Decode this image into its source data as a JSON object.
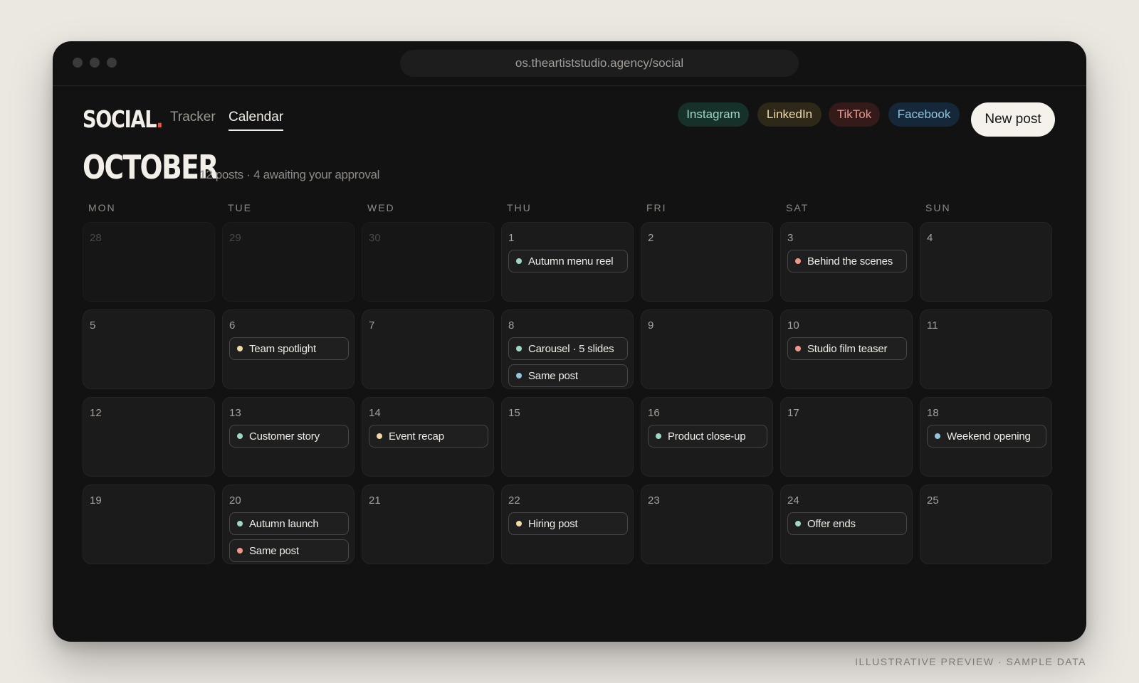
{
  "browser": {
    "url": "os.theartiststudio.agency/social"
  },
  "app": {
    "logo": "SOCIAL",
    "logo_dot": "."
  },
  "nav": {
    "tabs": [
      {
        "label": "Tracker",
        "active": false
      },
      {
        "label": "Calendar",
        "active": true
      }
    ]
  },
  "platforms": [
    {
      "label": "Instagram",
      "color": "#9fd6c4",
      "bg": "#15312a"
    },
    {
      "label": "LinkedIn",
      "color": "#efd9a6",
      "bg": "#2e2819"
    },
    {
      "label": "TikTok",
      "color": "#f0978a",
      "bg": "#341a18"
    },
    {
      "label": "Facebook",
      "color": "#93c4de",
      "bg": "#14283a"
    }
  ],
  "new_post_label": "New post",
  "calendar": {
    "month": "OCTOBER",
    "subtitle": "12 posts · 4 awaiting your approval",
    "weekdays": [
      "MON",
      "TUE",
      "WED",
      "THU",
      "FRI",
      "SAT",
      "SUN"
    ],
    "weeks": [
      [
        {
          "day": "28",
          "muted": true,
          "posts": []
        },
        {
          "day": "29",
          "muted": true,
          "posts": []
        },
        {
          "day": "30",
          "muted": true,
          "posts": []
        },
        {
          "day": "1",
          "posts": [
            {
              "title": "Autumn menu reel",
              "platform": "instagram"
            }
          ]
        },
        {
          "day": "2",
          "posts": []
        },
        {
          "day": "3",
          "posts": [
            {
              "title": "Behind the scenes",
              "platform": "tiktok"
            }
          ]
        },
        {
          "day": "4",
          "posts": []
        }
      ],
      [
        {
          "day": "5",
          "posts": []
        },
        {
          "day": "6",
          "posts": [
            {
              "title": "Team spotlight",
              "platform": "linkedin"
            }
          ]
        },
        {
          "day": "7",
          "posts": []
        },
        {
          "day": "8",
          "posts": [
            {
              "title": "Carousel · 5 slides",
              "platform": "instagram"
            },
            {
              "title": "Same post",
              "platform": "facebook"
            }
          ]
        },
        {
          "day": "9",
          "posts": []
        },
        {
          "day": "10",
          "posts": [
            {
              "title": "Studio film teaser",
              "platform": "tiktok"
            }
          ]
        },
        {
          "day": "11",
          "posts": []
        }
      ],
      [
        {
          "day": "12",
          "posts": []
        },
        {
          "day": "13",
          "posts": [
            {
              "title": "Customer story",
              "platform": "instagram"
            }
          ]
        },
        {
          "day": "14",
          "posts": [
            {
              "title": "Event recap",
              "platform": "linkedin"
            }
          ]
        },
        {
          "day": "15",
          "posts": []
        },
        {
          "day": "16",
          "posts": [
            {
              "title": "Product close-up",
              "platform": "instagram"
            }
          ]
        },
        {
          "day": "17",
          "posts": []
        },
        {
          "day": "18",
          "posts": [
            {
              "title": "Weekend opening",
              "platform": "facebook"
            }
          ]
        }
      ],
      [
        {
          "day": "19",
          "posts": []
        },
        {
          "day": "20",
          "posts": [
            {
              "title": "Autumn launch",
              "platform": "instagram"
            },
            {
              "title": "Same post",
              "platform": "tiktok"
            }
          ]
        },
        {
          "day": "21",
          "posts": []
        },
        {
          "day": "22",
          "posts": [
            {
              "title": "Hiring post",
              "platform": "linkedin"
            }
          ]
        },
        {
          "day": "23",
          "posts": []
        },
        {
          "day": "24",
          "posts": [
            {
              "title": "Offer ends",
              "platform": "instagram"
            }
          ]
        },
        {
          "day": "25",
          "posts": []
        }
      ]
    ]
  },
  "platform_dot_colors": {
    "instagram": "#9fd6c4",
    "linkedin": "#efd9a6",
    "tiktok": "#f0978a",
    "facebook": "#93c4de"
  },
  "footer": "ILLUSTRATIVE PREVIEW · SAMPLE DATA"
}
